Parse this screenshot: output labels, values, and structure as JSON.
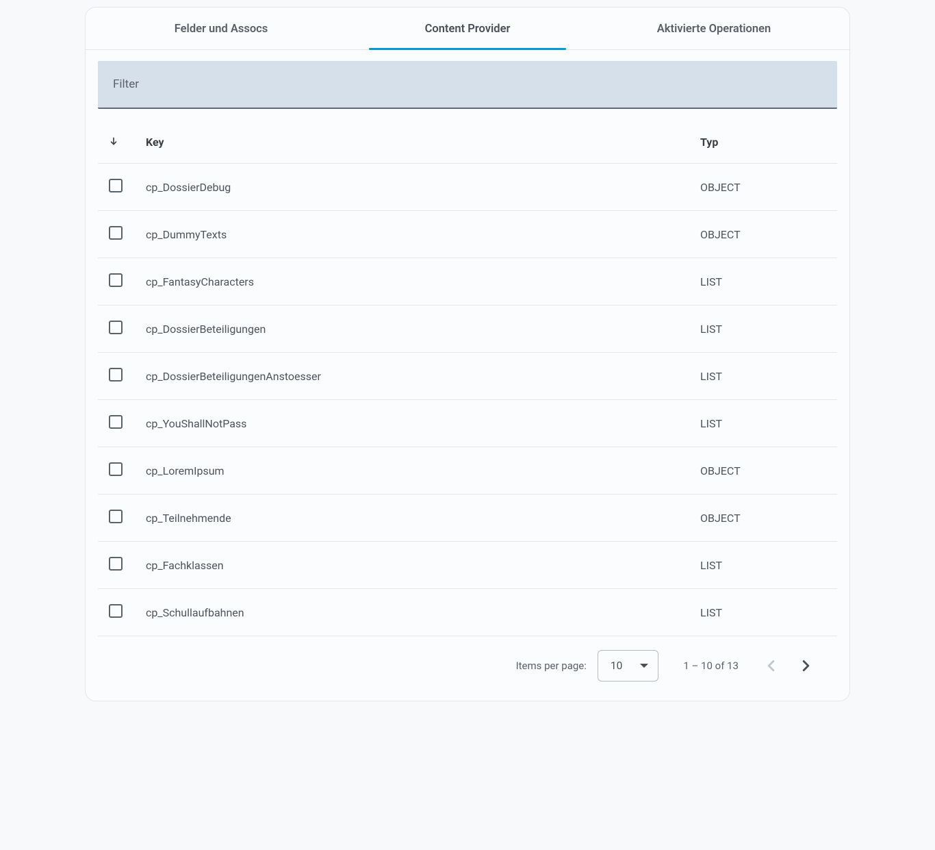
{
  "tabs": [
    {
      "label": "Felder und Assocs",
      "active": false
    },
    {
      "label": "Content Provider",
      "active": true
    },
    {
      "label": "Aktivierte Operationen",
      "active": false
    }
  ],
  "filter": {
    "label": "Filter"
  },
  "table": {
    "headers": {
      "key": "Key",
      "type": "Typ"
    },
    "rows": [
      {
        "key": "cp_DossierDebug",
        "type": "OBJECT"
      },
      {
        "key": "cp_DummyTexts",
        "type": "OBJECT"
      },
      {
        "key": "cp_FantasyCharacters",
        "type": "LIST"
      },
      {
        "key": "cp_DossierBeteiligungen",
        "type": "LIST"
      },
      {
        "key": "cp_DossierBeteiligungenAnstoesser",
        "type": "LIST"
      },
      {
        "key": "cp_YouShallNotPass",
        "type": "LIST"
      },
      {
        "key": "cp_LoremIpsum",
        "type": "OBJECT"
      },
      {
        "key": "cp_Teilnehmende",
        "type": "OBJECT"
      },
      {
        "key": "cp_Fachklassen",
        "type": "LIST"
      },
      {
        "key": "cp_Schullaufbahnen",
        "type": "LIST"
      }
    ]
  },
  "pagination": {
    "items_per_page_label": "Items per page:",
    "page_size": "10",
    "range": "1 – 10 of 13"
  }
}
